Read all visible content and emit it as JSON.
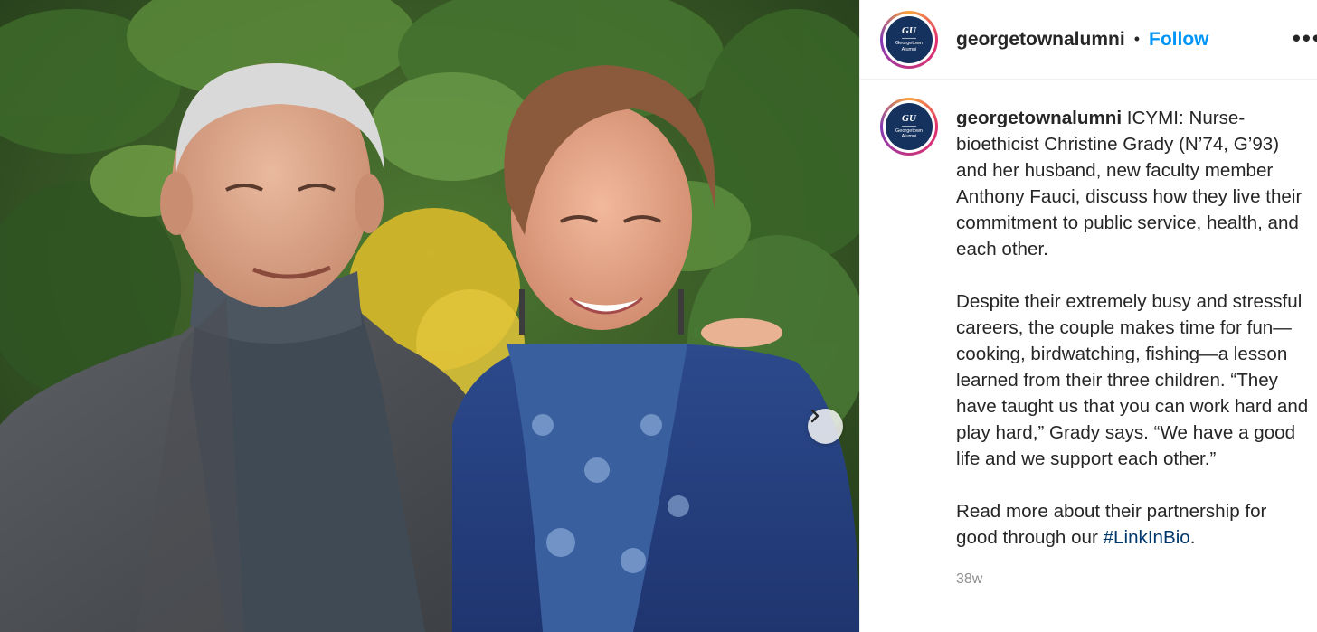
{
  "post": {
    "username": "georgetownalumni",
    "separator": "•",
    "follow_label": "Follow",
    "more_label": "•••",
    "avatar": {
      "monogram": "GU",
      "line1": "Georgetown",
      "line2": "Alumni",
      "bg_color": "#15325f"
    },
    "caption": {
      "author": "georgetownalumni",
      "para1": "ICYMI: Nurse-bioethicist Christine Grady (N’74, G’93) and her husband, new faculty member Anthony Fauci, discuss how they live their commitment to public service, health, and each other.",
      "para2": "Despite their extremely busy and stressful careers, the couple makes time for fun—cooking, birdwatching, fishing—a lesson learned from their three children. “They have taught us that you can work hard and play hard,” Grady says. “We have a good life and we support each other.”",
      "para3_prefix": "Read more about their partnership for good through our ",
      "hashtag": "#LinkInBio",
      "para3_suffix": "."
    },
    "timestamp": "38w",
    "next_icon": "chevron-right-icon",
    "colors": {
      "accent": "#0095f6",
      "hashtag": "#00376b",
      "text": "#262626",
      "muted": "#8e8e8e"
    }
  }
}
